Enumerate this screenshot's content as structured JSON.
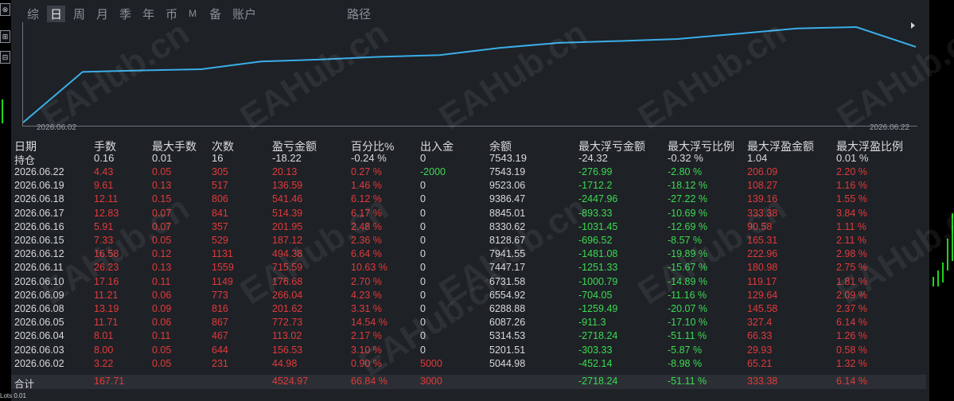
{
  "tabs": [
    "综",
    "日",
    "周",
    "月",
    "季",
    "年",
    "币",
    "M",
    "备",
    "账户",
    "路径"
  ],
  "active_tab": "日",
  "side_buttons": [
    "⊗",
    "⊞",
    "⊟"
  ],
  "chart_data": {
    "type": "line",
    "x_start_label": "2026.06.02",
    "x_end_label": "2026.06.22",
    "color": "#3aaee8"
  },
  "watermark": "EAHub.cn",
  "status_text": "Lots 0.01",
  "table": {
    "headers": [
      "日期",
      "手数",
      "最大手数",
      "次数",
      "盈亏金额",
      "百分比%",
      "出入金",
      "余额",
      "最大浮亏金额",
      "最大浮亏比例",
      "最大浮盈金额",
      "最大浮盈比例"
    ],
    "position": [
      "持仓",
      "0.16",
      "0.01",
      "16",
      "-18.22",
      "-0.24 %",
      "0",
      "7543.19",
      "-24.32",
      "-0.32 %",
      "1.04",
      "0.01 %"
    ],
    "rows": [
      [
        "2026.06.22",
        "4.43",
        "0.05",
        "305",
        "20.13",
        "0.27 %",
        "-2000",
        "7543.19",
        "-276.99",
        "-2.80 %",
        "206.09",
        "2.20 %"
      ],
      [
        "2026.06.19",
        "9.61",
        "0.13",
        "517",
        "136.59",
        "1.46 %",
        "0",
        "9523.06",
        "-1712.2",
        "-18.12 %",
        "108.27",
        "1.16 %"
      ],
      [
        "2026.06.18",
        "12.11",
        "0.15",
        "806",
        "541.46",
        "6.12 %",
        "0",
        "9386.47",
        "-2447.96",
        "-27.22 %",
        "139.16",
        "1.55 %"
      ],
      [
        "2026.06.17",
        "12.83",
        "0.07",
        "841",
        "514.39",
        "6.17 %",
        "0",
        "8845.01",
        "-893.33",
        "-10.69 %",
        "333.38",
        "3.84 %"
      ],
      [
        "2026.06.16",
        "5.91",
        "0.07",
        "357",
        "201.95",
        "2.48 %",
        "0",
        "8330.62",
        "-1031.45",
        "-12.69 %",
        "90.58",
        "1.11 %"
      ],
      [
        "2026.06.15",
        "7.33",
        "0.05",
        "529",
        "187.12",
        "2.36 %",
        "0",
        "8128.67",
        "-696.52",
        "-8.57 %",
        "165.31",
        "2.11 %"
      ],
      [
        "2026.06.12",
        "16.58",
        "0.12",
        "1131",
        "494.38",
        "6.64 %",
        "0",
        "7941.55",
        "-1481.08",
        "-19.89 %",
        "222.96",
        "2.98 %"
      ],
      [
        "2026.06.11",
        "26.23",
        "0.13",
        "1559",
        "715.59",
        "10.63 %",
        "0",
        "7447.17",
        "-1251.33",
        "-15.67 %",
        "180.98",
        "2.75 %"
      ],
      [
        "2026.06.10",
        "17.16",
        "0.11",
        "1149",
        "176.68",
        "2.70 %",
        "0",
        "6731.58",
        "-1000.79",
        "-14.89 %",
        "119.17",
        "1.81 %"
      ],
      [
        "2026.06.09",
        "11.21",
        "0.06",
        "773",
        "266.04",
        "4.23 %",
        "0",
        "6554.92",
        "-704.05",
        "-11.16 %",
        "129.64",
        "2.09 %"
      ],
      [
        "2026.06.08",
        "13.19",
        "0.09",
        "816",
        "201.62",
        "3.31 %",
        "0",
        "6288.88",
        "-1259.49",
        "-20.07 %",
        "145.58",
        "2.37 %"
      ],
      [
        "2026.06.05",
        "11.71",
        "0.06",
        "867",
        "772.73",
        "14.54 %",
        "0",
        "6087.26",
        "-911.3",
        "-17.10 %",
        "327.4",
        "6.14 %"
      ],
      [
        "2026.06.04",
        "8.01",
        "0.11",
        "467",
        "113.02",
        "2.17 %",
        "0",
        "5314.53",
        "-2718.24",
        "-51.11 %",
        "66.33",
        "1.26 %"
      ],
      [
        "2026.06.03",
        "8.00",
        "0.05",
        "644",
        "156.53",
        "3.10 %",
        "0",
        "5201.51",
        "-303.33",
        "-5.87 %",
        "29.93",
        "0.58 %"
      ],
      [
        "2026.06.02",
        "3.22",
        "0.05",
        "231",
        "44.98",
        "0.90 %",
        "5000",
        "5044.98",
        "-452.14",
        "-8.98 %",
        "65.21",
        "1.32 %"
      ]
    ],
    "total": [
      "合计",
      "167.71",
      "",
      "",
      "4524.97",
      "66.84 %",
      "3000",
      "",
      "-2718.24",
      "-51.11 %",
      "333.38",
      "6.14 %"
    ]
  }
}
